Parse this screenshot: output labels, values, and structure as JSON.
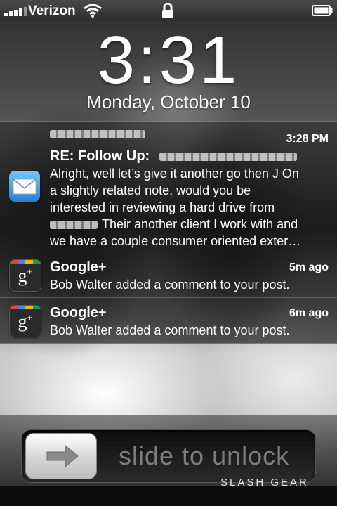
{
  "status_bar": {
    "carrier": "Verizon",
    "icons": [
      "signal-icon",
      "wifi-icon",
      "lock-icon",
      "battery-icon"
    ]
  },
  "lock_screen": {
    "time": "3:31",
    "date": "Monday, October 10"
  },
  "notifications": [
    {
      "app": "Mail",
      "icon": "mail-icon",
      "sender": "",
      "time": "3:28 PM",
      "subject": "RE: Follow Up:",
      "body_lines": [
        "Alright, well let’s give it another go then J On",
        "a slightly related note, would you be",
        "interested in reviewing a hard drive from",
        "Their another client I work with and",
        "we have a couple consumer oriented exter…"
      ]
    },
    {
      "app": "Google+",
      "icon": "google-plus-icon",
      "time": "5m ago",
      "body": "Bob Walter added a comment to your post."
    },
    {
      "app": "Google+",
      "icon": "google-plus-icon",
      "time": "6m ago",
      "body": "Bob Walter added a comment to your post."
    }
  ],
  "unlock": {
    "label": "slide to unlock",
    "knob_icon": "right-arrow-icon"
  },
  "watermark": "SLASH GEAR",
  "colors": {
    "google_plus_bar": [
      "#db4437",
      "#4285f4",
      "#f4b400",
      "#0f9d58"
    ],
    "mail_icon": "#2a7fd0"
  }
}
